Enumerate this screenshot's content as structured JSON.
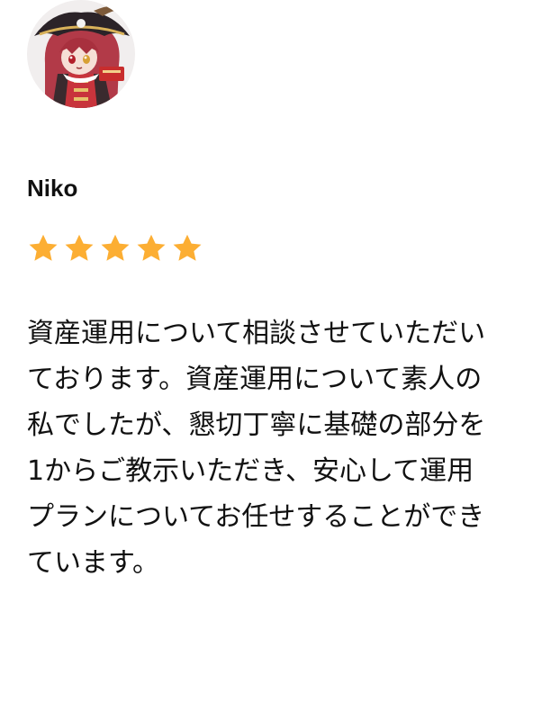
{
  "review": {
    "reviewer_name": "Niko",
    "avatar_icon": "avatar-character-icon",
    "rating": 5,
    "rating_max": 5,
    "star_color": "#FCAE33",
    "body": "資産運用について相談させていただい\nております。資産運用について素人の\n私でしたが、懇切丁寧に基礎の部分を\n1からご教示いただき、安心して運用\nプランについてお任せすることができ\nています。"
  }
}
